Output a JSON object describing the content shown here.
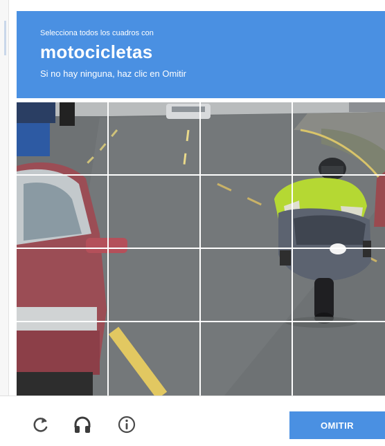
{
  "challenge": {
    "instruction": "Selecciona todos los cuadros con",
    "keyword": "motocicletas",
    "hint": "Si no hay ninguna, haz clic en Omitir",
    "header_color": "#4a90e2"
  },
  "grid": {
    "rows": 4,
    "cols": 4
  },
  "footer": {
    "reload_icon": "reload-icon",
    "audio_icon": "headphones-icon",
    "info_icon": "info-icon",
    "skip_label": "OMITIR"
  }
}
